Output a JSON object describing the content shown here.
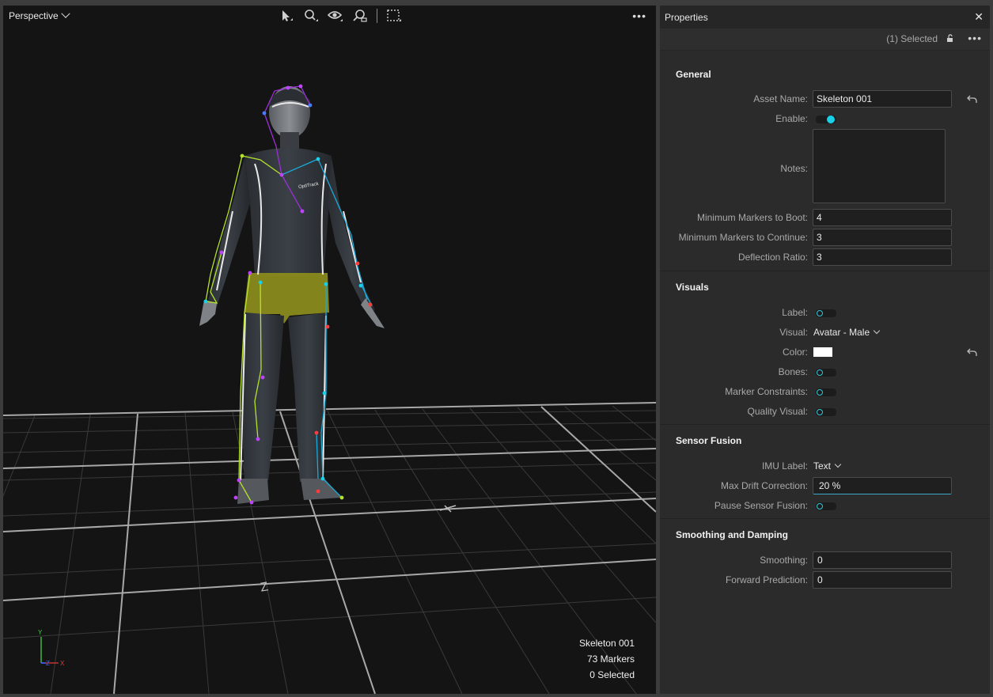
{
  "viewport": {
    "view_mode": "Perspective",
    "hud": {
      "asset_name": "Skeleton 001",
      "markers": "73 Markers",
      "selected": "0 Selected"
    },
    "axis_labels": {
      "y": "Y",
      "z": "Z",
      "x": "X"
    },
    "grid_labels": {
      "z": "Z"
    },
    "chest_logo": "OptiTrack"
  },
  "properties": {
    "title": "Properties",
    "selection": "(1) Selected",
    "sections": {
      "general": {
        "title": "General",
        "asset_name_label": "Asset Name:",
        "asset_name_value": "Skeleton 001",
        "enable_label": "Enable:",
        "enable_on": true,
        "notes_label": "Notes:",
        "min_boot_label": "Minimum Markers to Boot:",
        "min_boot_value": "4",
        "min_continue_label": "Minimum Markers to Continue:",
        "min_continue_value": "3",
        "deflection_label": "Deflection Ratio:",
        "deflection_value": "3"
      },
      "visuals": {
        "title": "Visuals",
        "label_label": "Label:",
        "visual_label": "Visual:",
        "visual_value": "Avatar - Male",
        "color_label": "Color:",
        "color_value": "#ffffff",
        "bones_label": "Bones:",
        "marker_constraints_label": "Marker Constraints:",
        "quality_visual_label": "Quality Visual:"
      },
      "sensor_fusion": {
        "title": "Sensor Fusion",
        "imu_label_label": "IMU Label:",
        "imu_label_value": "Text",
        "max_drift_label": "Max Drift Correction:",
        "max_drift_value": "20 %",
        "pause_label": "Pause Sensor Fusion:"
      },
      "smoothing": {
        "title": "Smoothing and Damping",
        "smoothing_label": "Smoothing:",
        "smoothing_value": "0",
        "forward_label": "Forward Prediction:",
        "forward_value": "0"
      }
    }
  },
  "colors": {
    "accent": "#19d0e8",
    "viewport_bg": "#141414",
    "panel_bg": "#2b2b2b",
    "grid": "#9a9a9a"
  },
  "icons": [
    "select-arrow-icon",
    "zoom-icon",
    "eye-icon",
    "zoom-region-icon",
    "marquee-select-icon",
    "more-icon",
    "close-icon",
    "lock-icon",
    "revert-icon"
  ]
}
